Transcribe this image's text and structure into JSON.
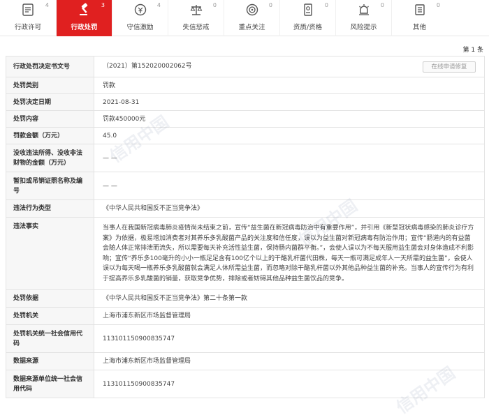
{
  "tabs": [
    {
      "label": "行政许可",
      "count": "4",
      "icon": "license-icon"
    },
    {
      "label": "行政处罚",
      "count": "3",
      "icon": "gavel-icon"
    },
    {
      "label": "守信激励",
      "count": "4",
      "icon": "credit-reward-icon"
    },
    {
      "label": "失信惩戒",
      "count": "0",
      "icon": "scale-icon"
    },
    {
      "label": "重点关注",
      "count": "0",
      "icon": "target-icon"
    },
    {
      "label": "资质/资格",
      "count": "0",
      "icon": "qualification-icon"
    },
    {
      "label": "风险提示",
      "count": "0",
      "icon": "alarm-icon"
    },
    {
      "label": "其他",
      "count": "0",
      "icon": "other-icon"
    }
  ],
  "accent_color": "#e02020",
  "pager": "第 1 条",
  "apply_button": "在线申请修复",
  "watermark": "信用中国",
  "rows": [
    {
      "key": "行政处罚决定书文号",
      "value": "（2021）第152020002062号"
    },
    {
      "key": "处罚类别",
      "value": "罚款"
    },
    {
      "key": "处罚决定日期",
      "value": "2021-08-31"
    },
    {
      "key": "处罚内容",
      "value": "罚款450000元"
    },
    {
      "key": "罚款金额（万元）",
      "value": "45.0"
    },
    {
      "key": "没收违法所得、没收非法财物的金额（万元）",
      "value": "— —"
    },
    {
      "key": "暂扣或吊销证照名称及编号",
      "value": "— —"
    },
    {
      "key": "违法行为类型",
      "value": "《中华人民共和国反不正当竞争法》"
    },
    {
      "key": "违法事实",
      "value": "当事人在我国新冠病毒肺炎疫情尚未结束之前，宣传“益生菌在新冠病毒防治中有重要作用”，并引用《新型冠状病毒感染的肺炎诊疗方案》为依据，极易增加消费者对其养乐多乳酸菌产品的关注度和信任度，误以为益生菌对新冠病毒有防治作用；宣传“肠道内的有益菌会随人体正常排泄而流失，所以需要每天补充活性益生菌，保持肠内菌群平衡。”，会使人误以为不每天服用益生菌会对身体造成不利影响；宣传“养乐多100毫升的小小一瓶足足含有100亿个以上的干酪乳杆菌代田株，每天一瓶可满足成年人一天所需的益生菌”，会使人误以为每天喝一瓶养乐多乳酸菌就会满足人体所需益生菌，而忽略对除干酪乳杆菌以外其他品种益生菌的补充。当事人的宣传行为有利于提高养乐多乳酸菌的销量，获取竞争优势，排除或者妨碍其他品种益生菌饮品的竞争。"
    },
    {
      "key": "处罚依据",
      "value": "《中华人民共和国反不正当竞争法》第二十条第一款"
    },
    {
      "key": "处罚机关",
      "value": "上海市浦东新区市场监督管理局"
    },
    {
      "key": "处罚机关统一社会信用代码",
      "value": "113101150900835747"
    },
    {
      "key": "数据来源",
      "value": "上海市浦东新区市场监督管理局"
    },
    {
      "key": "数据来源单位统一社会信用代码",
      "value": "113101150900835747"
    }
  ]
}
